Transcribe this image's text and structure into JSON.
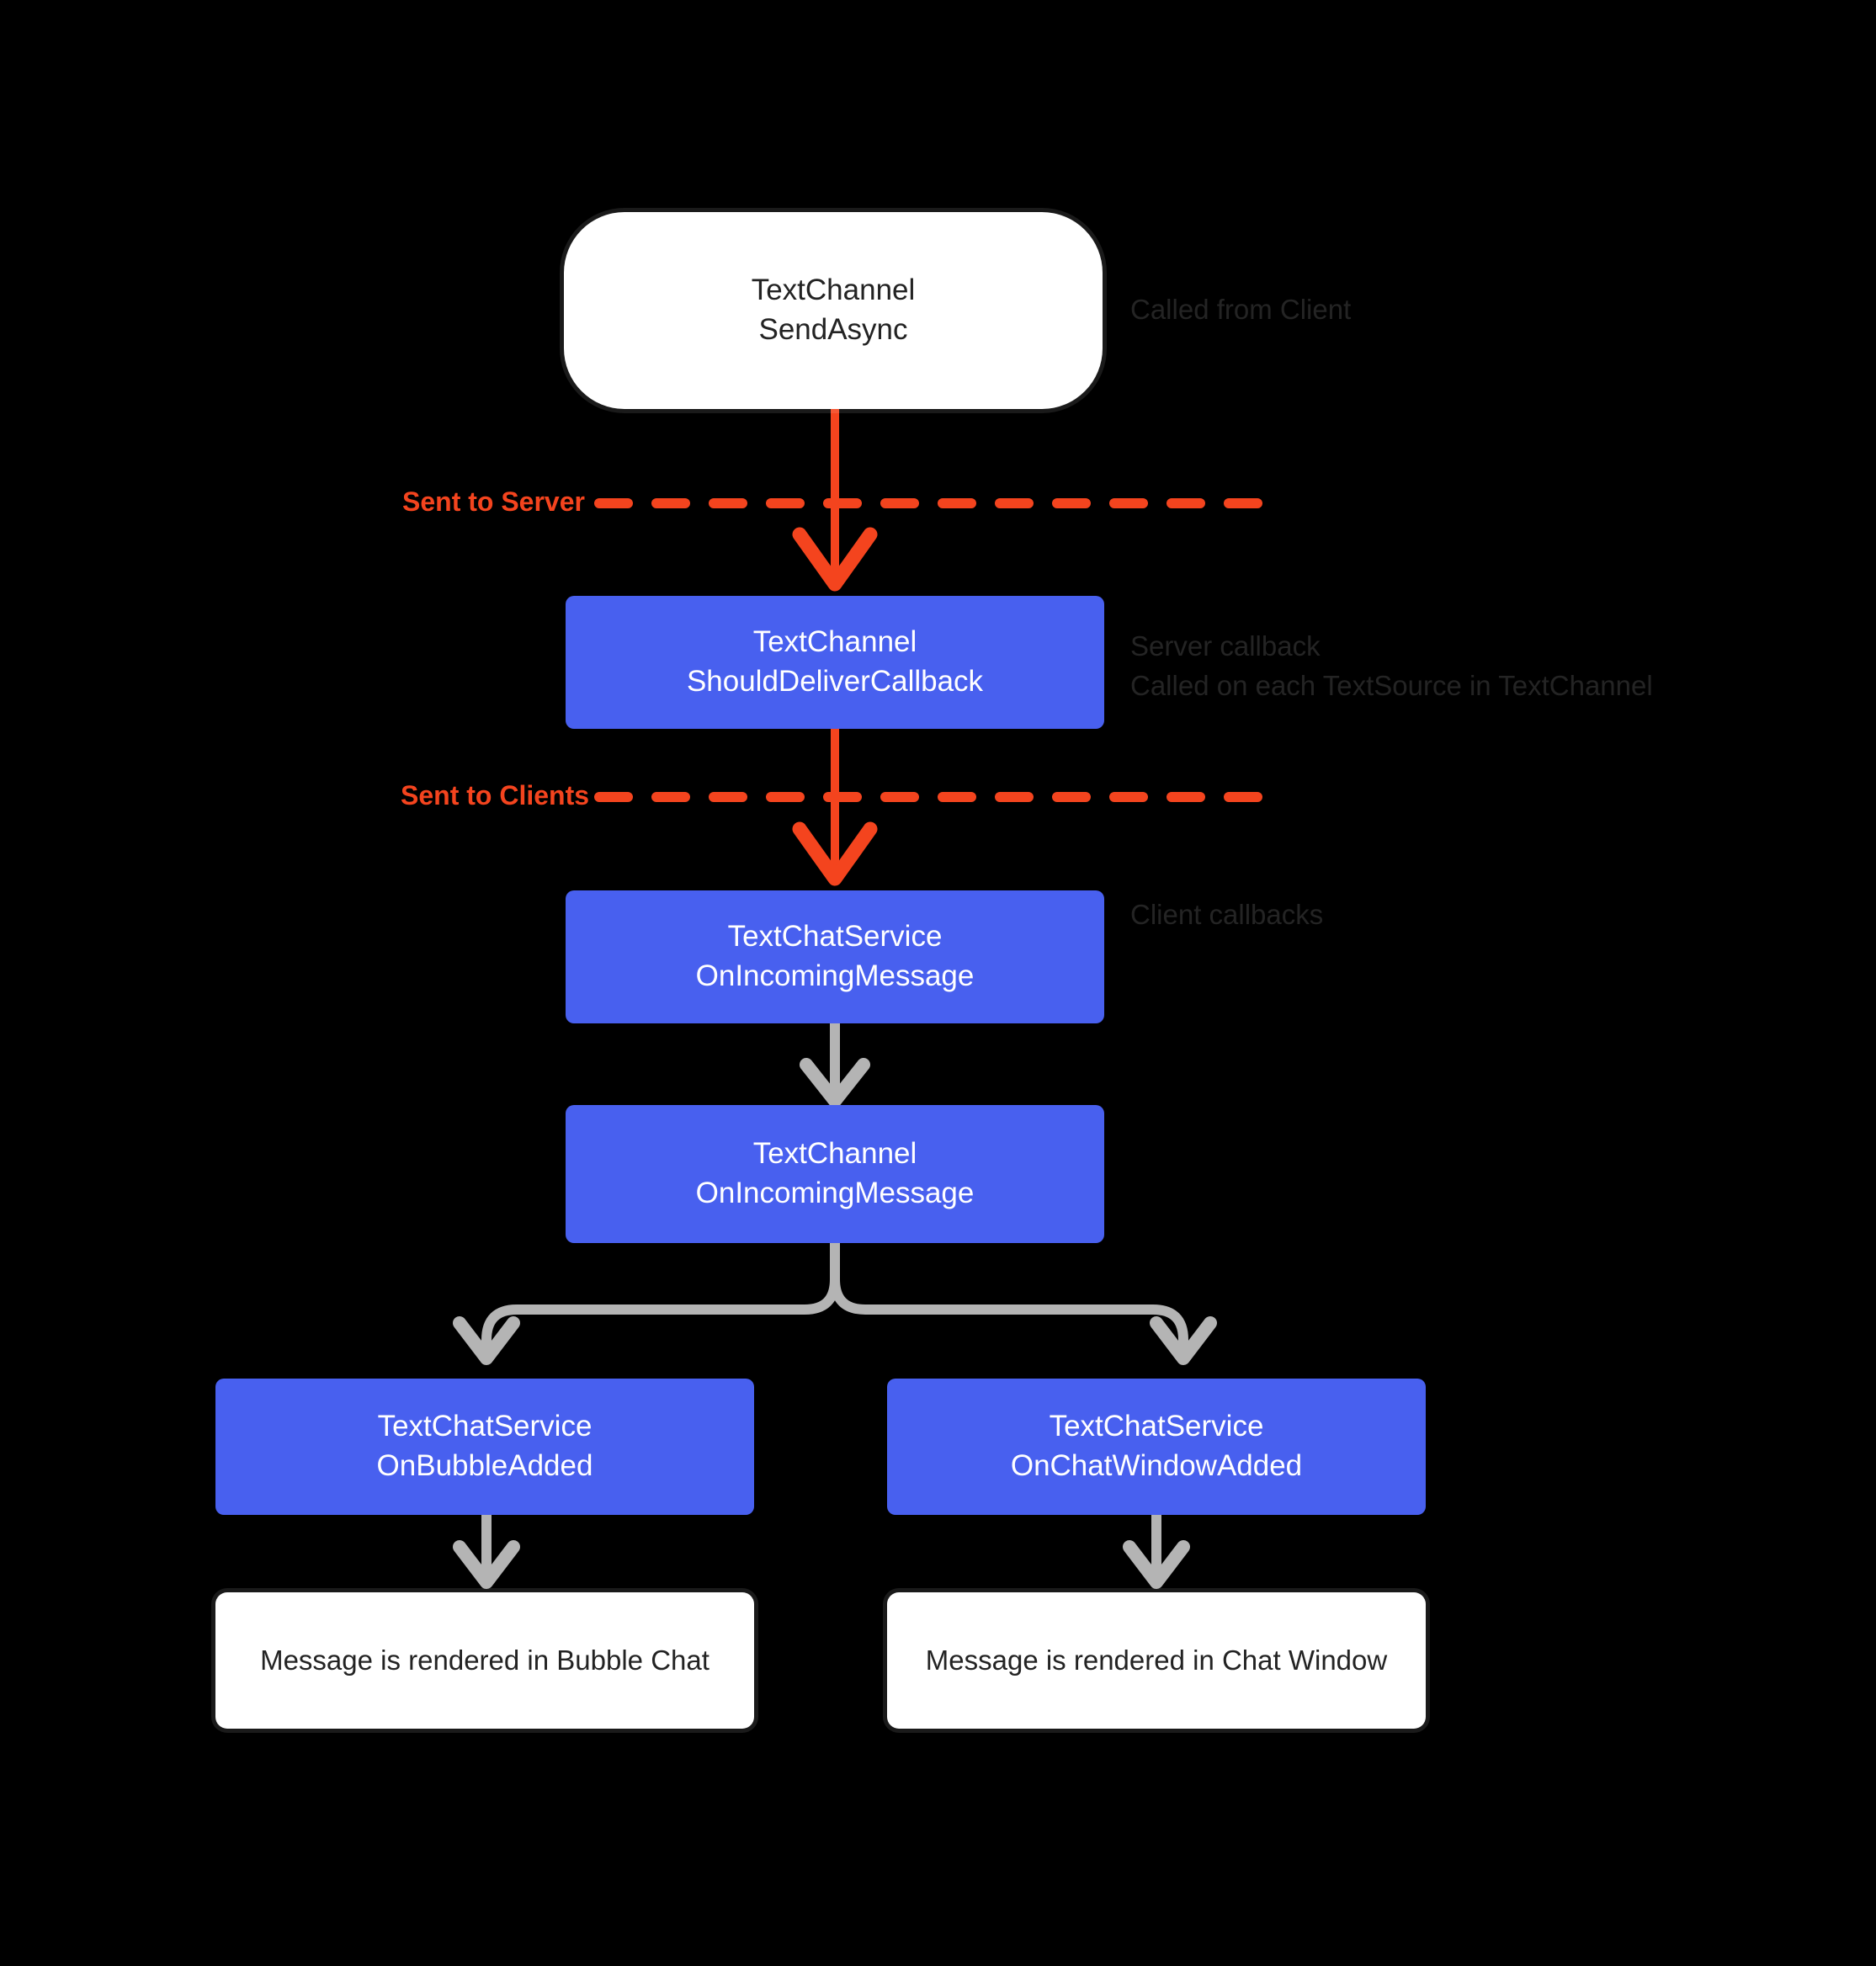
{
  "diagram": {
    "title": "TextChannel message flow",
    "background_color": "#000000",
    "accent_red": "#f4441e",
    "accent_blue": "#4860ef",
    "accent_gray": "#b4b4b4"
  },
  "nodes": {
    "send_async": {
      "line1": "TextChannel",
      "line2": "SendAsync"
    },
    "should_deliver": {
      "line1": "TextChannel",
      "line2": "ShouldDeliverCallback"
    },
    "service_incoming": {
      "line1": "TextChatService",
      "line2": "OnIncomingMessage"
    },
    "channel_incoming": {
      "line1": "TextChannel",
      "line2": "OnIncomingMessage"
    },
    "bubble_added": {
      "line1": "TextChatService",
      "line2": "OnBubbleAdded"
    },
    "chat_window_added": {
      "line1": "TextChatService",
      "line2": "OnChatWindowAdded"
    },
    "bubble_result": {
      "line1": "Message is rendered in Bubble Chat"
    },
    "chat_window_result": {
      "line1": "Message is rendered in Chat Window"
    }
  },
  "annotations": {
    "called_from_client": {
      "line1": "Called from Client"
    },
    "server_callback": {
      "line1": "Server callback",
      "line2": "Called on each TextSource in TextChannel"
    },
    "client_callbacks": {
      "line1": "Client callbacks"
    }
  },
  "boundaries": {
    "sent_to_server": "Sent to Server",
    "sent_to_clients": "Sent to Clients"
  }
}
